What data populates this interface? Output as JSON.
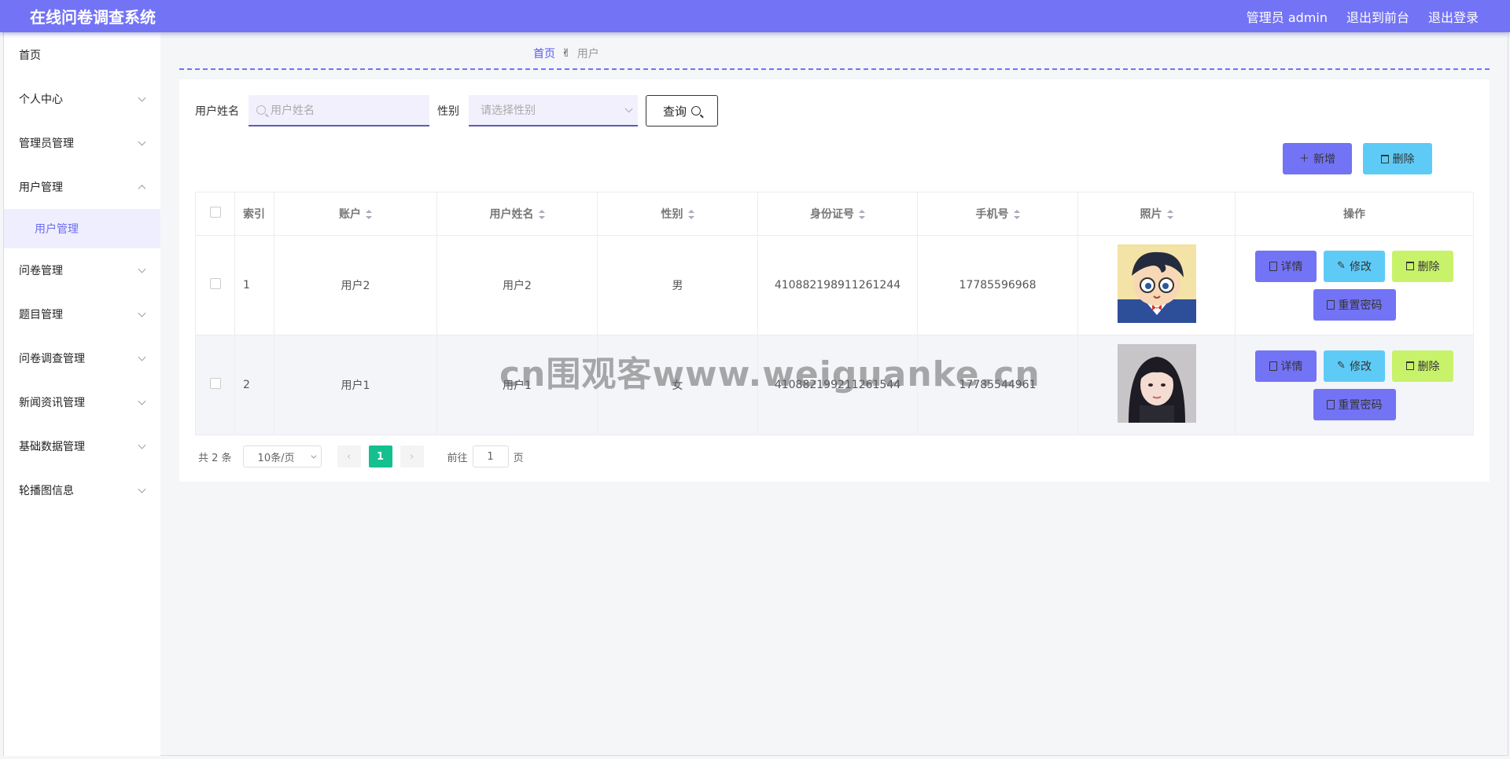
{
  "header": {
    "title": "在线问卷调查系统",
    "user": "管理员 admin",
    "to_front": "退出到前台",
    "logout": "退出登录"
  },
  "sidebar": {
    "items": [
      {
        "label": "首页"
      },
      {
        "label": "个人中心"
      },
      {
        "label": "管理员管理"
      },
      {
        "label": "用户管理"
      },
      {
        "label": "问卷管理"
      },
      {
        "label": "题目管理"
      },
      {
        "label": "问卷调查管理"
      },
      {
        "label": "新闻资讯管理"
      },
      {
        "label": "基础数据管理"
      },
      {
        "label": "轮播图信息"
      }
    ],
    "submenu": {
      "label": "用户管理"
    }
  },
  "breadcrumb": {
    "home": "首页",
    "separator": "✌",
    "current": "用户"
  },
  "search": {
    "name_label": "用户姓名",
    "name_placeholder": "用户姓名",
    "gender_label": "性别",
    "gender_placeholder": "请选择性别",
    "query_button": "查询"
  },
  "actions": {
    "add": "新增",
    "delete": "删除"
  },
  "table": {
    "headers": [
      "索引",
      "账户",
      "用户姓名",
      "性别",
      "身份证号",
      "手机号",
      "照片",
      "操作"
    ],
    "rows": [
      {
        "index": "1",
        "account": "用户2",
        "name": "用户2",
        "gender": "男",
        "id_card": "410882198911261244",
        "phone": "17785596968",
        "photo": "avatar-cartoon-boy"
      },
      {
        "index": "2",
        "account": "用户1",
        "name": "用户1",
        "gender": "女",
        "id_card": "410882199211261544",
        "phone": "17785544961",
        "photo": "avatar-girl"
      }
    ],
    "row_buttons": {
      "detail": "详情",
      "edit": "修改",
      "delete": "删除",
      "reset": "重置密码"
    }
  },
  "pagination": {
    "total": "共 2 条",
    "page_size": "10条/页",
    "current_page": "1",
    "goto_prefix": "前往",
    "goto_value": "1",
    "goto_suffix": "页"
  },
  "watermark": "cn围观客www.weiguanke.cn",
  "colors": {
    "primary": "#7373f6",
    "cyan": "#5ecbf7",
    "lime": "#c8f26a",
    "pager_active": "#13c08e"
  }
}
